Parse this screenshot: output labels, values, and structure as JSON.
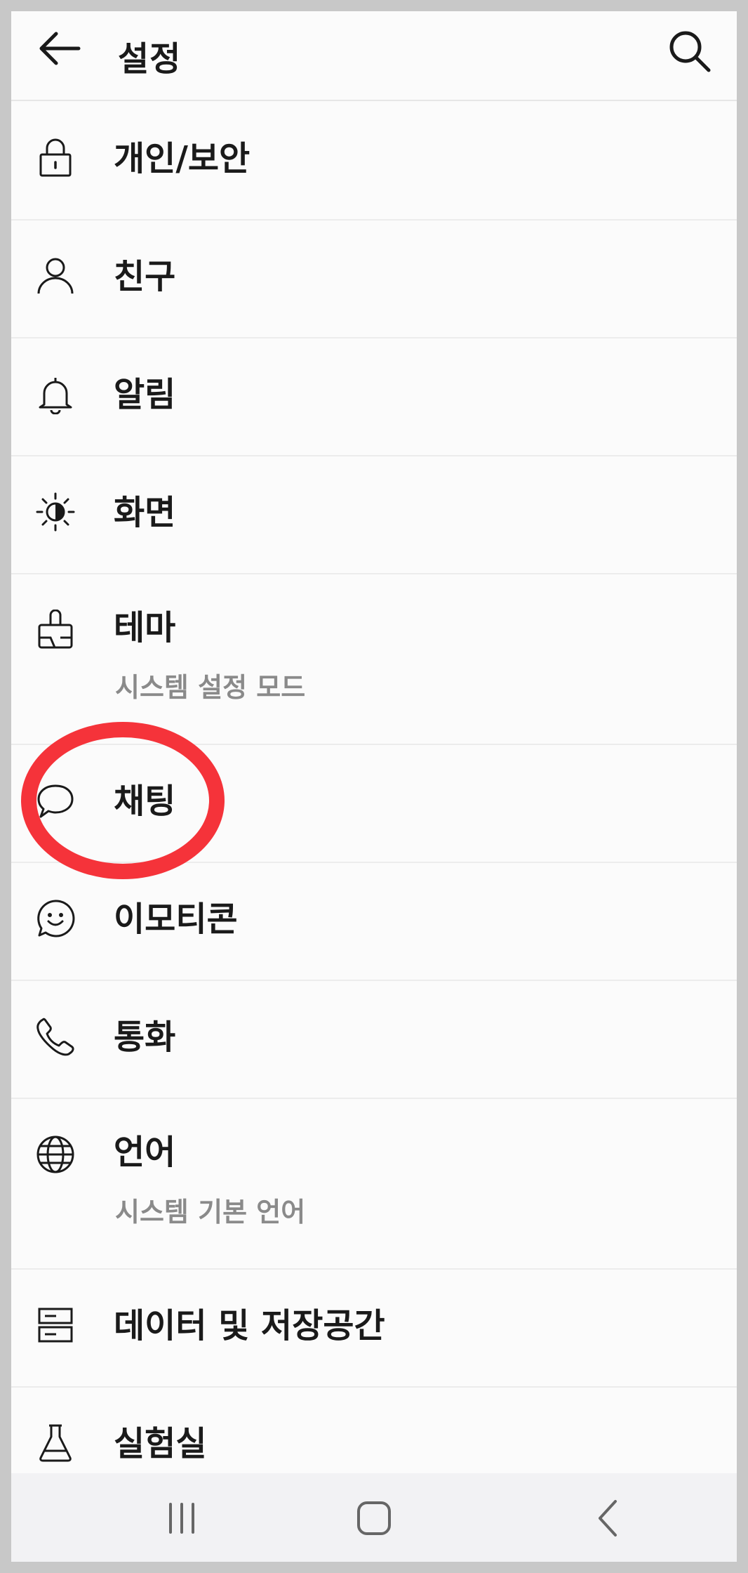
{
  "header": {
    "title": "설정",
    "back_icon": "arrow-left-icon",
    "search_icon": "search-icon"
  },
  "menu": {
    "items": [
      {
        "label": "개인/보안",
        "icon": "lock-icon"
      },
      {
        "label": "친구",
        "icon": "person-icon"
      },
      {
        "label": "알림",
        "icon": "bell-icon"
      },
      {
        "label": "화면",
        "icon": "brightness-icon"
      },
      {
        "label": "테마",
        "sub": "시스템 설정 모드",
        "icon": "paint-brush-icon"
      },
      {
        "label": "채팅",
        "icon": "chat-bubble-icon"
      },
      {
        "label": "이모티콘",
        "icon": "emoticon-icon"
      },
      {
        "label": "통화",
        "icon": "phone-icon"
      },
      {
        "label": "언어",
        "sub": "시스템 기본 언어",
        "icon": "globe-icon"
      },
      {
        "label": "데이터 및 저장공간",
        "icon": "storage-icon"
      },
      {
        "label": "실험실",
        "icon": "flask-icon"
      }
    ]
  },
  "annotation": {
    "highlight_color": "#f5333a"
  },
  "navbar": {
    "recents_icon": "recents-icon",
    "home_icon": "home-icon",
    "back_icon": "back-chevron-icon"
  }
}
